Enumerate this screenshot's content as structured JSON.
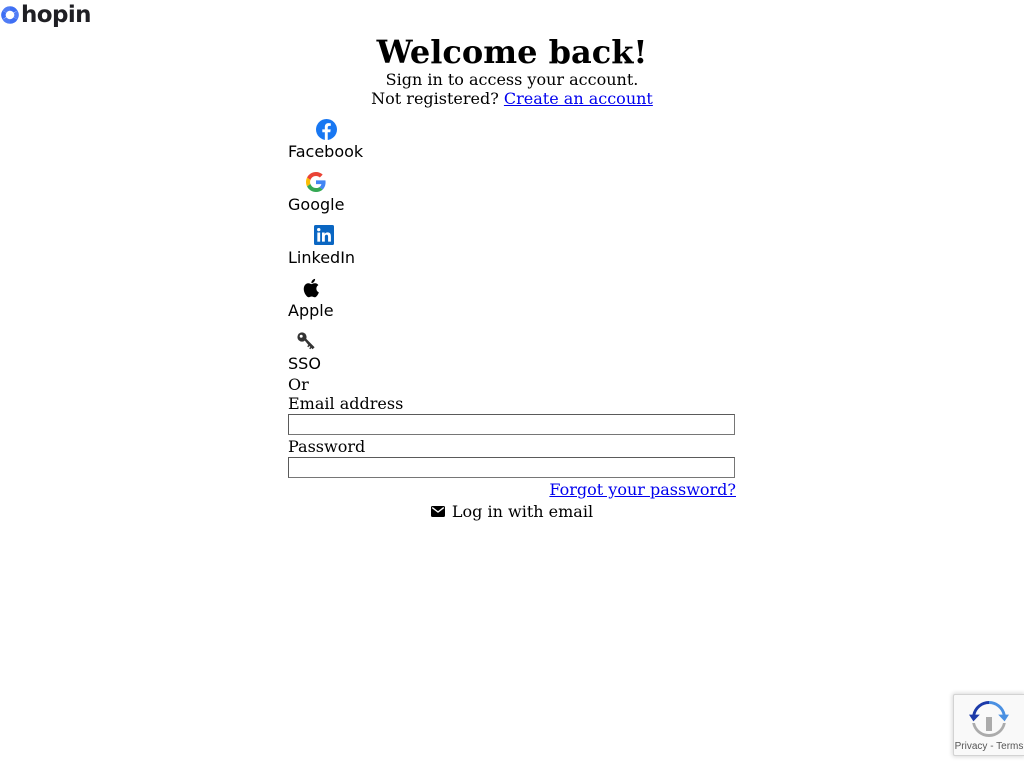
{
  "brand": {
    "name": "hopin",
    "color": "#1f1f24",
    "mark_color": "#3e6ff4"
  },
  "header": {
    "title": "Welcome back!",
    "subtitle": "Sign in to access your account.",
    "register_prompt": "Not registered?",
    "register_link": "Create an account"
  },
  "social": [
    {
      "icon": "facebook-icon",
      "label": "Facebook",
      "color": "#1877f2"
    },
    {
      "icon": "google-icon",
      "label": "Google"
    },
    {
      "icon": "linkedin-icon",
      "label": "LinkedIn",
      "color": "#0a66c2"
    },
    {
      "icon": "apple-icon",
      "label": "Apple",
      "color": "#000000"
    },
    {
      "icon": "key-icon",
      "label": "SSO",
      "color": "#333333"
    }
  ],
  "divider": "Or",
  "form": {
    "email_label": "Email address",
    "email_value": "",
    "password_label": "Password",
    "password_value": "",
    "forgot_link": "Forgot your password?",
    "submit_label": "Log in with email",
    "submit_icon": "envelope-icon"
  },
  "recaptcha": {
    "privacy": "Privacy",
    "separator": " - ",
    "terms": "Terms"
  }
}
